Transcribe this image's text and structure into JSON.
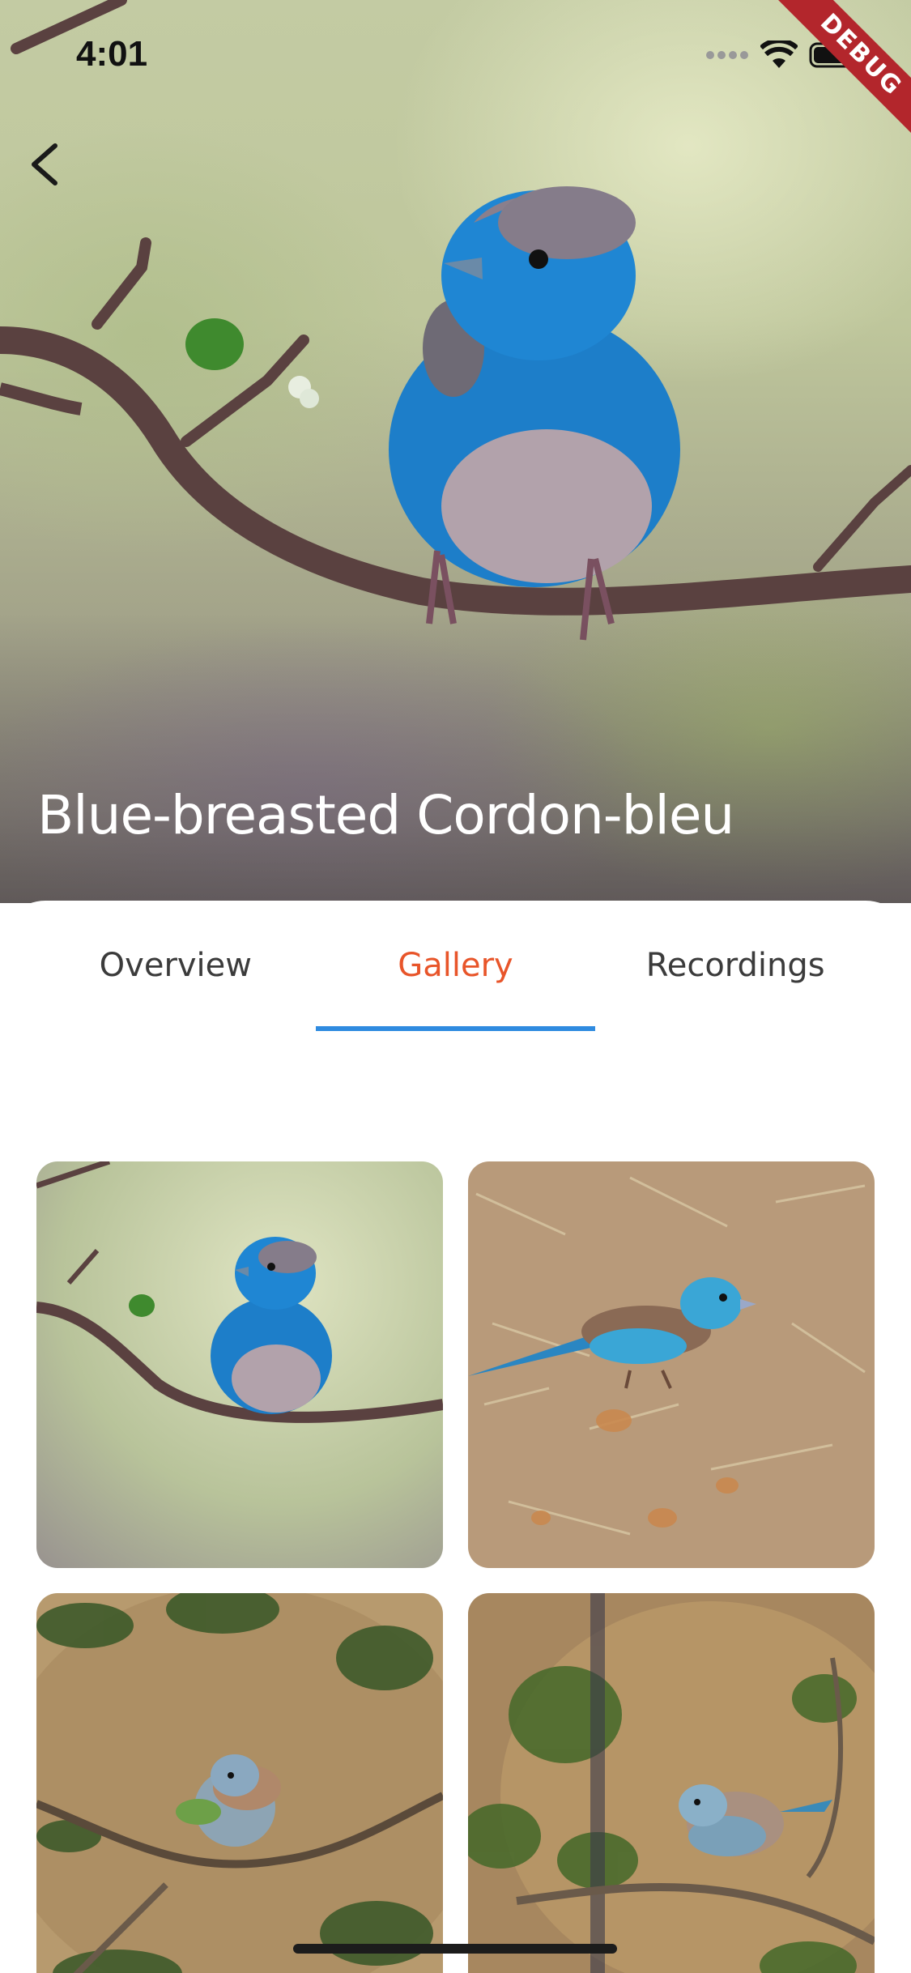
{
  "status_bar": {
    "time": "4:01",
    "icons": [
      "signal-icon",
      "wifi-icon",
      "battery-icon"
    ],
    "debug_label": "DEBUG"
  },
  "header": {
    "back_icon": "chevron-left-icon",
    "title": "Blue-breasted Cordon-bleu"
  },
  "tabs": [
    {
      "label": "Overview",
      "active": false
    },
    {
      "label": "Gallery",
      "active": true
    },
    {
      "label": "Recordings",
      "active": false
    }
  ],
  "colors": {
    "active_tab_text": "#e8552a",
    "tab_indicator": "#2f8be0",
    "debug_banner": "#b3262c"
  },
  "gallery": {
    "images": [
      {
        "name": "gallery-image-1"
      },
      {
        "name": "gallery-image-2"
      },
      {
        "name": "gallery-image-3"
      },
      {
        "name": "gallery-image-4"
      }
    ]
  }
}
